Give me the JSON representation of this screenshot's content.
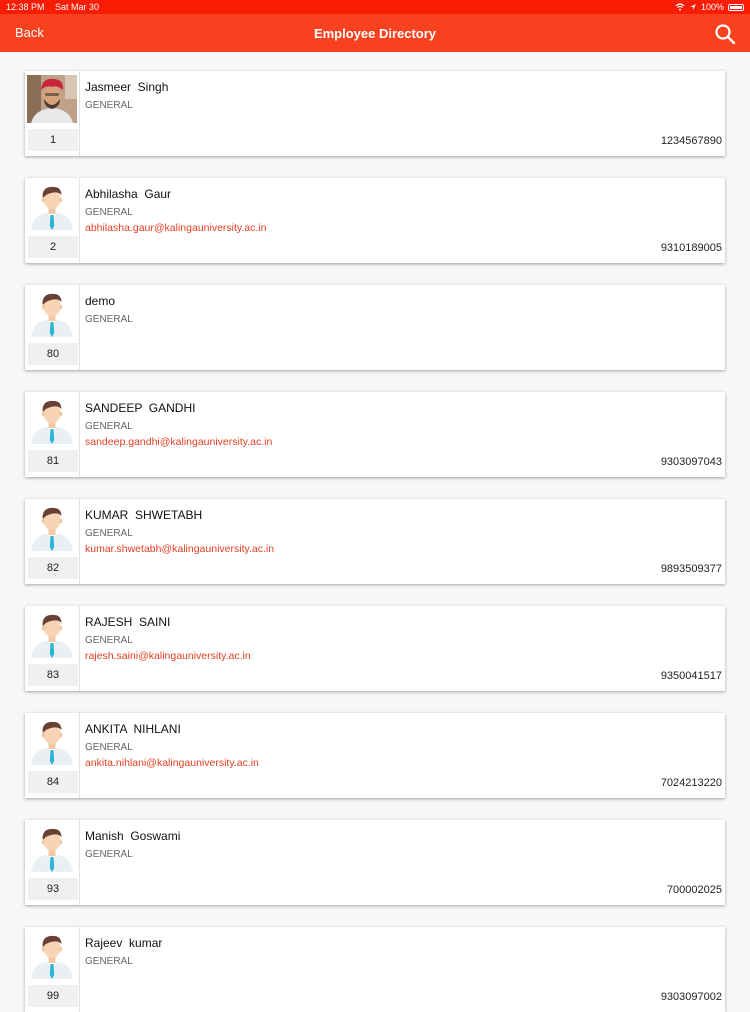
{
  "status_bar": {
    "time": "12:38 PM",
    "date": "Sat Mar 30",
    "battery": "100%"
  },
  "header": {
    "back_label": "Back",
    "title": "Employee Directory"
  },
  "colors": {
    "accent": "#f8421f",
    "email": "#e23e22"
  },
  "employees": [
    {
      "id": "1",
      "name": "Jasmeer  Singh",
      "dept": "GENERAL",
      "email": "",
      "phone": "1234567890",
      "avatar": "photo"
    },
    {
      "id": "2",
      "name": "Abhilasha  Gaur",
      "dept": "GENERAL",
      "email": "abhilasha.gaur@kalingauniversity.ac.in",
      "phone": "9310189005",
      "avatar": "placeholder"
    },
    {
      "id": "80",
      "name": "demo",
      "dept": "GENERAL",
      "email": "",
      "phone": "",
      "avatar": "placeholder"
    },
    {
      "id": "81",
      "name": "SANDEEP  GANDHI",
      "dept": "GENERAL",
      "email": "sandeep.gandhi@kalingauniversity.ac.in",
      "phone": "9303097043",
      "avatar": "placeholder"
    },
    {
      "id": "82",
      "name": "KUMAR  SHWETABH",
      "dept": "GENERAL",
      "email": "kumar.shwetabh@kalingauniversity.ac.in",
      "phone": "9893509377",
      "avatar": "placeholder"
    },
    {
      "id": "83",
      "name": "RAJESH  SAINI",
      "dept": "GENERAL",
      "email": "rajesh.saini@kalingauniversity.ac.in",
      "phone": "9350041517",
      "avatar": "placeholder"
    },
    {
      "id": "84",
      "name": "ANKITA  NIHLANI",
      "dept": "GENERAL",
      "email": "ankita.nihlani@kalingauniversity.ac.in",
      "phone": "7024213220",
      "avatar": "placeholder"
    },
    {
      "id": "93",
      "name": "Manish  Goswami",
      "dept": "GENERAL",
      "email": "",
      "phone": "700002025",
      "avatar": "placeholder"
    },
    {
      "id": "99",
      "name": "Rajeev  kumar",
      "dept": "GENERAL",
      "email": "",
      "phone": "9303097002",
      "avatar": "placeholder"
    }
  ]
}
